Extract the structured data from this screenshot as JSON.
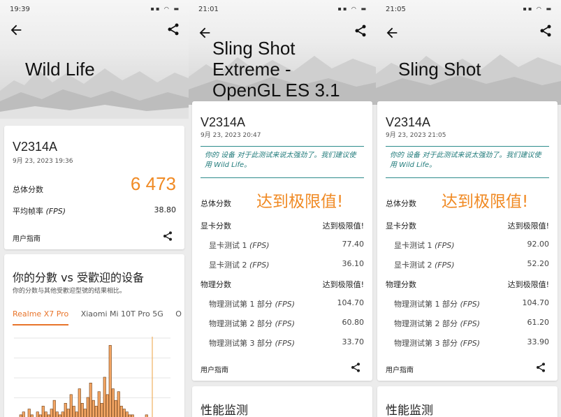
{
  "panels": [
    {
      "status_time": "19:39",
      "title_lines": [
        "Wild Life"
      ],
      "device": "V2314A",
      "date": "9月 23, 2023 19:36",
      "overall_label": "总体分数",
      "overall_score": "6 473",
      "fps_label": "平均帧率",
      "fps_unit": "(FPS)",
      "fps_value": "38.80",
      "guide": "用户指南",
      "compare_title": "你的分數 vs 受歡迎的设备",
      "compare_sub": "你的分数与其他受歡迎型號的结果相比。",
      "compare_tabs": [
        "Realme X7 Pro",
        "Xiaomi Mi 10T Pro 5G",
        "O"
      ]
    },
    {
      "status_time": "21:01",
      "title_lines": [
        "Sling Shot",
        "Extreme -",
        "OpenGL ES 3.1"
      ],
      "device": "V2314A",
      "date": "9月 23, 2023 20:47",
      "notice": "你的 设备 对于此测试来说太强劲了。我们建议使用 Wild Life。",
      "overall_label": "总体分数",
      "limit_big": "达到极限值!",
      "graphics_label": "显卡分数",
      "graphics_value": "达到极限值!",
      "gt1_label": "显卡测试 1",
      "gt1_value": "77.40",
      "gt2_label": "显卡测试 2",
      "gt2_value": "36.10",
      "physics_label": "物理分数",
      "physics_value": "达到极限值!",
      "pt1_label": "物理测试第 1 部分",
      "pt1_value": "104.70",
      "pt2_label": "物理测试第 2 部分",
      "pt2_value": "60.80",
      "pt3_label": "物理测试第 3 部分",
      "pt3_value": "33.70",
      "fps_unit": "(FPS)",
      "guide": "用户指南",
      "monitor_title": "性能监测"
    },
    {
      "status_time": "21:05",
      "title_lines": [
        "Sling Shot"
      ],
      "device": "V2314A",
      "date": "9月 23, 2023 21:05",
      "notice": "你的 设备 对于此测试来说太强劲了。我们建议使用 Wild Life。",
      "overall_label": "总体分数",
      "limit_big": "达到极限值!",
      "graphics_label": "显卡分数",
      "graphics_value": "达到极限值!",
      "gt1_label": "显卡测试 1",
      "gt1_value": "92.00",
      "gt2_label": "显卡测试 2",
      "gt2_value": "52.20",
      "physics_label": "物理分数",
      "physics_value": "达到极限值!",
      "pt1_label": "物理测试第 1 部分",
      "pt1_value": "104.70",
      "pt2_label": "物理测试第 2 部分",
      "pt2_value": "61.20",
      "pt3_label": "物理测试第 3 部分",
      "pt3_value": "33.90",
      "fps_unit": "(FPS)",
      "guide": "用户指南",
      "monitor_title": "性能监测"
    }
  ],
  "colors": {
    "accent": "#f08a24",
    "notice": "#1f7a7a",
    "tab_active": "#e8742a"
  },
  "chart_data": {
    "type": "bar",
    "categories": [],
    "values": [
      0,
      0,
      1,
      2,
      0,
      3,
      1,
      0,
      2,
      1,
      4,
      2,
      1,
      3,
      6,
      2,
      1,
      2,
      5,
      3,
      8,
      4,
      2,
      10,
      5,
      3,
      7,
      12,
      6,
      4,
      9,
      5,
      14,
      8,
      25,
      10,
      6,
      9,
      4,
      3,
      2,
      1,
      1,
      0,
      0,
      0,
      0,
      1,
      0,
      0,
      0,
      0,
      0,
      0,
      0,
      0
    ],
    "ylim": [
      0,
      28
    ],
    "grid": true,
    "highlight_index": 49
  }
}
